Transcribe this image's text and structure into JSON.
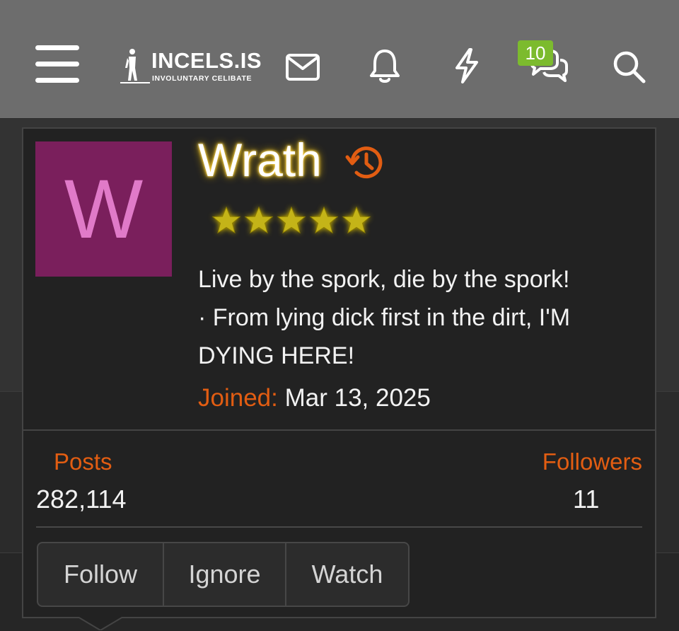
{
  "header": {
    "logo_title": "INCELS.IS",
    "logo_subtitle": "INVOLUNTARY CELIBATE",
    "chat_badge_count": "10",
    "icons": [
      "menu-icon",
      "mail-icon",
      "bell-icon",
      "bolt-icon",
      "chat-icon",
      "search-icon"
    ]
  },
  "member": {
    "avatar_letter": "W",
    "avatar_bg": "#7a1f5c",
    "avatar_fg": "#e07ac8",
    "username": "Wrath",
    "star_count": 5,
    "bio_line1": "Live by the spork, die by the spork!",
    "bio_line2": "· From lying dick first in the dirt, I'M",
    "bio_line3": "DYING HERE!",
    "joined_label": "Joined:",
    "joined_date": "Mar 13, 2025"
  },
  "stats": {
    "posts_label": "Posts",
    "posts_value": "282,114",
    "followers_label": "Followers",
    "followers_value": "11"
  },
  "actions": {
    "follow": "Follow",
    "ignore": "Ignore",
    "watch": "Watch"
  },
  "colors": {
    "accent": "#e25d12",
    "badge": "#7cbb2e",
    "header_bg": "#6d6d6d",
    "card_bg": "#222222"
  }
}
